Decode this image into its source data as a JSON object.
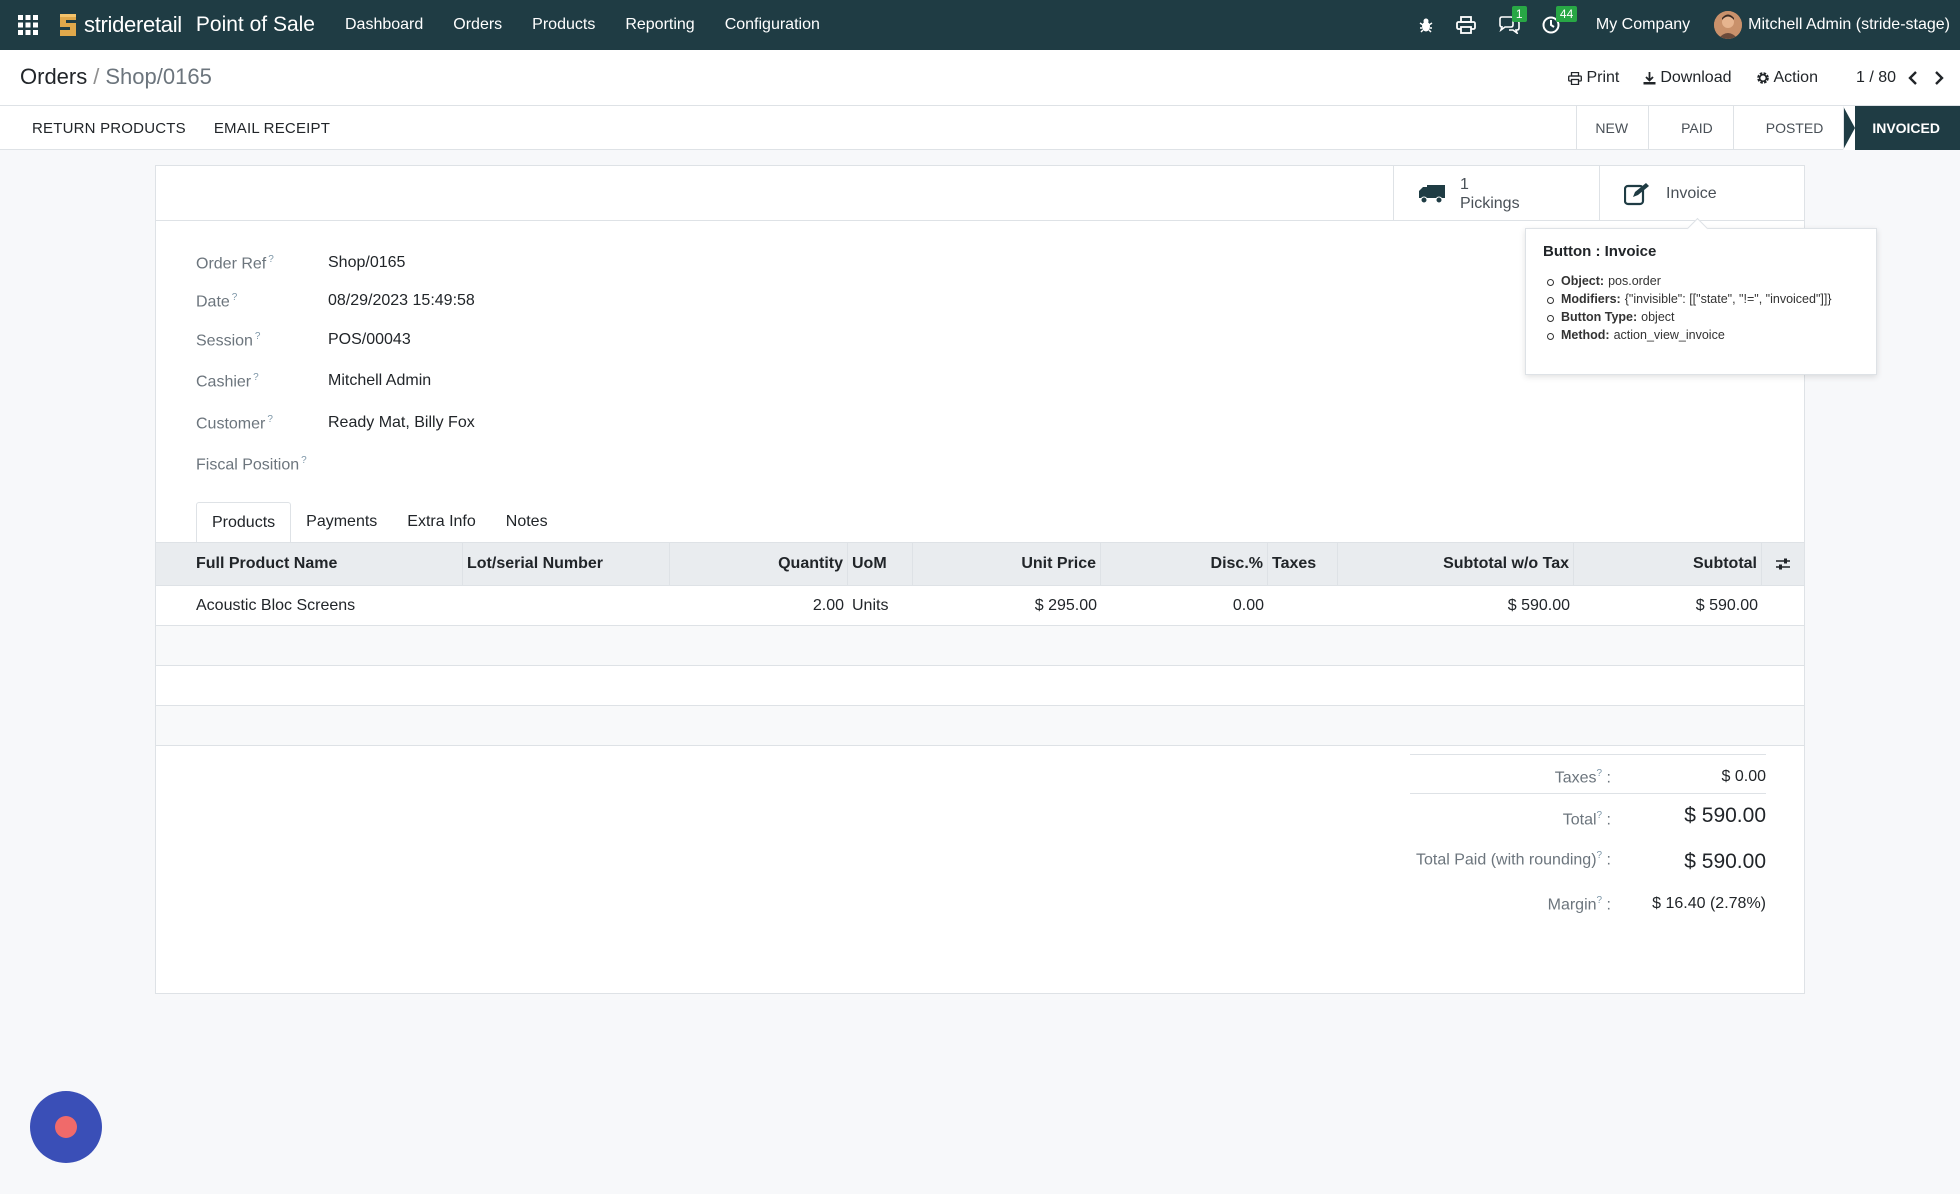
{
  "navbar": {
    "brand": "strideretail",
    "app_name": "Point of Sale",
    "menu": [
      "Dashboard",
      "Orders",
      "Products",
      "Reporting",
      "Configuration"
    ],
    "chat_badge": "1",
    "activity_badge": "44",
    "company": "My Company",
    "user": "Mitchell Admin (stride-stage)"
  },
  "control": {
    "breadcrumb_parent": "Orders",
    "breadcrumb_sep": "/",
    "breadcrumb_current": "Shop/0165",
    "print": "Print",
    "download": "Download",
    "action": "Action",
    "pager": "1 / 80"
  },
  "statusbar": {
    "buttons": [
      "RETURN PRODUCTS",
      "EMAIL RECEIPT"
    ],
    "stages": [
      "NEW",
      "PAID",
      "POSTED",
      "INVOICED"
    ],
    "active_stage": "INVOICED"
  },
  "smart_buttons": {
    "pickings_count": "1",
    "pickings_label": "Pickings",
    "invoice_label": "Invoice"
  },
  "fields": [
    {
      "label": "Order Ref",
      "value": "Shop/0165"
    },
    {
      "label": "Date",
      "value": "08/29/2023 15:49:58"
    },
    {
      "label": "Session",
      "value": "POS/00043"
    },
    {
      "label": "Cashier",
      "value": "Mitchell Admin"
    },
    {
      "label": "Customer",
      "value": "Ready Mat, Billy Fox"
    },
    {
      "label": "Fiscal Position",
      "value": ""
    }
  ],
  "help_mark": "?",
  "tabs": [
    "Products",
    "Payments",
    "Extra Info",
    "Notes"
  ],
  "table": {
    "headers": [
      "Full Product Name",
      "Lot/serial Number",
      "Quantity",
      "UoM",
      "Unit Price",
      "Disc.%",
      "Taxes",
      "Subtotal w/o Tax",
      "Subtotal"
    ],
    "rows": [
      {
        "product": "Acoustic Bloc Screens",
        "lot": "",
        "qty": "2.00",
        "uom": "Units",
        "unit_price": "$ 295.00",
        "disc": "0.00",
        "taxes": "",
        "subtotal_wo_tax": "$ 590.00",
        "subtotal": "$ 590.00"
      }
    ]
  },
  "totals": {
    "taxes_label": "Taxes",
    "taxes": "$ 0.00",
    "total_label": "Total",
    "total": "$ 590.00",
    "paid_label": "Total Paid (with rounding)",
    "paid": "$ 590.00",
    "margin_label": "Margin",
    "margin": "$ 16.40 (2.78%)",
    "colon": ":"
  },
  "tooltip": {
    "title": "Button : Invoice",
    "items": [
      {
        "key": "Object:",
        "value": "pos.order"
      },
      {
        "key": "Modifiers:",
        "value": "{\"invisible\": [[\"state\", \"!=\", \"invoiced\"]]}"
      },
      {
        "key": "Button Type:",
        "value": "object"
      },
      {
        "key": "Method:",
        "value": "action_view_invoice"
      }
    ]
  },
  "colors": {
    "navbar": "#1f3c44",
    "badge": "#28a745",
    "chat_bubble": "#3a4fb7"
  }
}
